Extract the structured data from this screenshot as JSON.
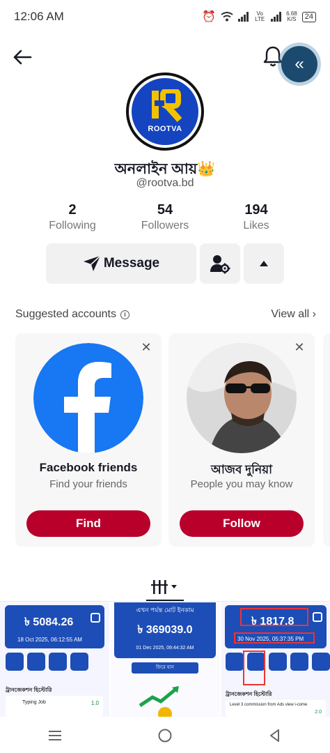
{
  "status_bar": {
    "time": "12:06 AM",
    "network_label": "Vo LTE",
    "speed_value": "6.68",
    "speed_unit": "K/S",
    "battery": "24"
  },
  "profile": {
    "display_name": "অনলাইন আয়👑",
    "username": "@rootva.bd",
    "logo_text": "ROOTVA",
    "stats": [
      {
        "value": "2",
        "label": "Following"
      },
      {
        "value": "54",
        "label": "Followers"
      },
      {
        "value": "194",
        "label": "Likes"
      }
    ],
    "message_label": "Message"
  },
  "suggested": {
    "title": "Suggested accounts",
    "view_all": "View all",
    "cards": [
      {
        "title": "Facebook friends",
        "subtitle": "Find your friends",
        "button": "Find"
      },
      {
        "title": "আজব দুনিয়া",
        "subtitle": "People you may know",
        "button": "Follow"
      }
    ]
  },
  "thumbnails": [
    {
      "amount": "৳ 5084.26",
      "date": "18 Oct 2025, 06:12:55 AM",
      "footer": "ট্রানজেকশন হিস্টোরি",
      "item_label": "Typing Job",
      "item_value": "1.0"
    },
    {
      "heading": "এখন পর্যন্ত মোট ইনকাম",
      "amount": "৳ 369039.0",
      "date": "01 Dec 2025, 09:44:32 AM",
      "button": "ফিরে যান"
    },
    {
      "amount": "৳ 1817.8",
      "date": "30 Nov 2025, 05:37:35 PM",
      "footer": "ট্রানজেকশন হিস্টোরি",
      "item_label": "Level 3 commission from Ads view i-come",
      "item_value": "2.0"
    }
  ],
  "colors": {
    "primary_red": "#b8002b",
    "floating_button": "#1c4a6e",
    "facebook_blue": "#1877f2",
    "thumb_blue": "#1d4db6"
  }
}
